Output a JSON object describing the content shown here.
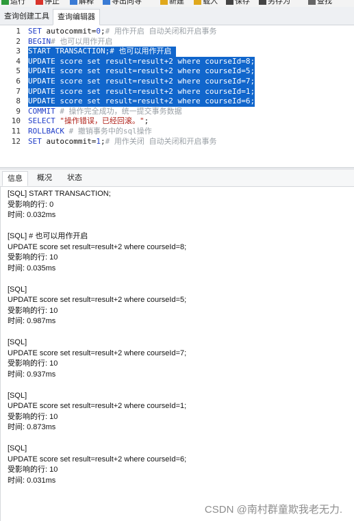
{
  "toolbar": {
    "buttons": [
      {
        "label": "运行",
        "color": "#2e9a3a"
      },
      {
        "label": "停止",
        "color": "#d9342b"
      },
      {
        "label": "解释",
        "color": "#3a7bd5"
      },
      {
        "label": "导出向导",
        "color": "#3a7bd5"
      },
      {
        "label": "新建",
        "color": "#e0a81c"
      },
      {
        "label": "载入",
        "color": "#e0a81c"
      },
      {
        "label": "保存",
        "color": "#444444"
      },
      {
        "label": "另存为",
        "color": "#444444"
      },
      {
        "label": "查找",
        "color": "#666666"
      }
    ]
  },
  "tabs": {
    "query_builder": "查询创建工具",
    "query_editor": "查询编辑器"
  },
  "editor": {
    "lines": [
      {
        "n": "1",
        "sel": false,
        "parts": [
          {
            "t": "SET",
            "c": "kw"
          },
          {
            "t": " autocommit=",
            "c": "ptxt"
          },
          {
            "t": "0",
            "c": "kw"
          },
          {
            "t": ";",
            "c": "ptxt"
          },
          {
            "t": "# 用作开启 自动关闭和开启事务",
            "c": "cm"
          }
        ]
      },
      {
        "n": "2",
        "sel": false,
        "parts": [
          {
            "t": "BEGIN",
            "c": "kw"
          },
          {
            "t": "# 也可以用作开启",
            "c": "cm"
          }
        ]
      },
      {
        "n": "3",
        "sel": true,
        "parts": [
          {
            "t": "START TRANSACTION;# 也可以用作开启 ",
            "c": "selt"
          }
        ]
      },
      {
        "n": "4",
        "sel": true,
        "parts": [
          {
            "t": "UPDATE score set result=result+2 where courseId=8;",
            "c": "selt"
          }
        ]
      },
      {
        "n": "5",
        "sel": true,
        "parts": [
          {
            "t": "UPDATE score set result=result+2 where courseId=5;",
            "c": "selt"
          }
        ]
      },
      {
        "n": "6",
        "sel": true,
        "parts": [
          {
            "t": "UPDATE score set result=result+2 where courseId=7;",
            "c": "selt"
          }
        ]
      },
      {
        "n": "7",
        "sel": true,
        "parts": [
          {
            "t": "UPDATE score set result=result+2 where courseId=1;",
            "c": "selt"
          }
        ]
      },
      {
        "n": "8",
        "sel": true,
        "parts": [
          {
            "t": "UPDATE score set result=result+2 where courseId=6;",
            "c": "selt"
          }
        ]
      },
      {
        "n": "9",
        "sel": false,
        "parts": [
          {
            "t": "COMMIT",
            "c": "kw"
          },
          {
            "t": " # 操作完全成功，统一提交事务数据",
            "c": "cm"
          }
        ]
      },
      {
        "n": "10",
        "sel": false,
        "parts": [
          {
            "t": "SELECT",
            "c": "kw"
          },
          {
            "t": " \"操作错误，已经回滚。\"",
            "c": "str"
          },
          {
            "t": ";",
            "c": "ptxt"
          }
        ]
      },
      {
        "n": "11",
        "sel": false,
        "parts": [
          {
            "t": "ROLLBACK",
            "c": "kw"
          },
          {
            "t": " # 撤销事务中的sql操作",
            "c": "cm"
          }
        ]
      },
      {
        "n": "12",
        "sel": false,
        "parts": [
          {
            "t": "SET",
            "c": "kw"
          },
          {
            "t": " autocommit=",
            "c": "ptxt"
          },
          {
            "t": "1",
            "c": "kw"
          },
          {
            "t": ";",
            "c": "ptxt"
          },
          {
            "t": "# 用作关闭 自动关闭和开启事务",
            "c": "cm"
          }
        ]
      }
    ]
  },
  "panel_tabs": {
    "info": "信息",
    "overview": "概况",
    "status": "状态"
  },
  "output": {
    "lines": [
      "[SQL] START TRANSACTION;",
      "受影响的行: 0",
      "时间: 0.032ms",
      "",
      "[SQL] # 也可以用作开启",
      "UPDATE score set result=result+2 where courseId=8;",
      "受影响的行: 10",
      "时间: 0.035ms",
      "",
      "[SQL]",
      "UPDATE score set result=result+2 where courseId=5;",
      "受影响的行: 10",
      "时间: 0.987ms",
      "",
      "[SQL]",
      "UPDATE score set result=result+2 where courseId=7;",
      "受影响的行: 10",
      "时间: 0.937ms",
      "",
      "[SQL]",
      "UPDATE score set result=result+2 where courseId=1;",
      "受影响的行: 10",
      "时间: 0.873ms",
      "",
      "[SQL]",
      "UPDATE score set result=result+2 where courseId=6;",
      "受影响的行: 10",
      "时间: 0.031ms"
    ]
  },
  "watermark": "CSDN @南村群童欺我老无力."
}
